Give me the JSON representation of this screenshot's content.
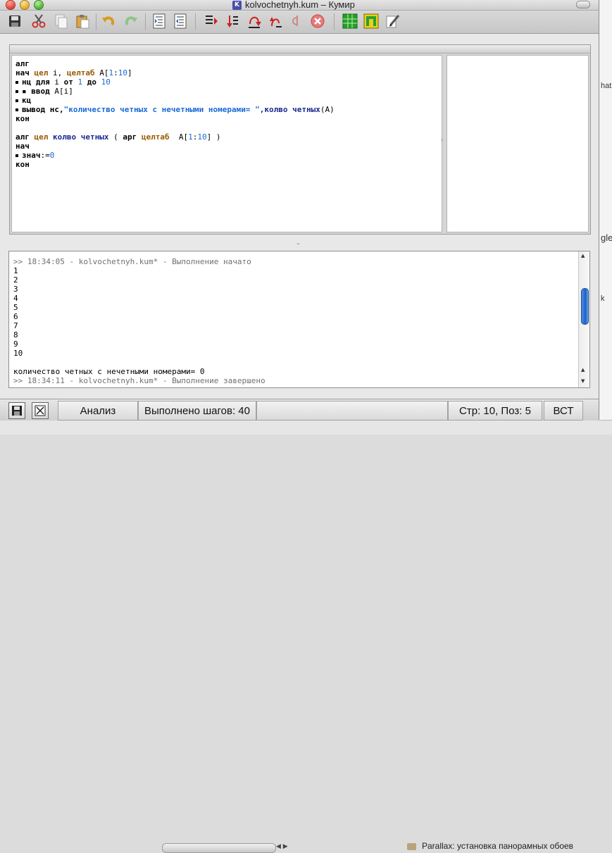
{
  "window": {
    "title": "kolvochetnyh.kum – Кумир",
    "app_icon": "K"
  },
  "toolbar": {
    "icons": [
      "save-icon",
      "cut-icon",
      "copy-icon",
      "paste-icon",
      "undo-icon",
      "redo-icon",
      "indent-icon",
      "outdent-icon",
      "run-icon",
      "step-in-icon",
      "step-over-icon",
      "step-out-icon",
      "step-back-icon",
      "stop-icon",
      "grid-robot-icon",
      "draw-board-icon",
      "pencil-icon"
    ]
  },
  "editor": {
    "lines": [
      {
        "mark": false,
        "segments": [
          {
            "t": "алг",
            "c": "kw"
          }
        ]
      },
      {
        "mark": false,
        "segments": [
          {
            "t": "нач ",
            "c": "kw"
          },
          {
            "t": "цел",
            "c": "ty"
          },
          {
            "t": " i, ",
            "c": "var"
          },
          {
            "t": "целтаб",
            "c": "ty"
          },
          {
            "t": " A[",
            "c": "var"
          },
          {
            "t": "1",
            "c": "num"
          },
          {
            "t": ":",
            "c": "var"
          },
          {
            "t": "10",
            "c": "num"
          },
          {
            "t": "]",
            "c": "var"
          }
        ]
      },
      {
        "mark": true,
        "segments": [
          {
            "t": "нц для ",
            "c": "kw"
          },
          {
            "t": "i ",
            "c": "var"
          },
          {
            "t": "от ",
            "c": "kw"
          },
          {
            "t": "1",
            "c": "num"
          },
          {
            "t": " до ",
            "c": "kw"
          },
          {
            "t": "10",
            "c": "num"
          }
        ]
      },
      {
        "mark": true,
        "segments": [
          {
            "t": "▪ ",
            "c": "var"
          },
          {
            "t": "ввод ",
            "c": "kw"
          },
          {
            "t": "A[i]",
            "c": "var"
          }
        ]
      },
      {
        "mark": true,
        "segments": [
          {
            "t": "кц",
            "c": "kw"
          }
        ]
      },
      {
        "mark": true,
        "segments": [
          {
            "t": "вывод нс,",
            "c": "kw"
          },
          {
            "t": "\"количество четных с нечетными номерами= \"",
            "c": "str"
          },
          {
            "t": ",колво четных",
            "c": "fn"
          },
          {
            "t": "(A)",
            "c": "var"
          }
        ]
      },
      {
        "mark": false,
        "segments": [
          {
            "t": "кон",
            "c": "kw"
          }
        ]
      },
      {
        "mark": false,
        "segments": [
          {
            "t": "",
            "c": "var"
          }
        ]
      },
      {
        "mark": false,
        "segments": [
          {
            "t": "алг ",
            "c": "kw"
          },
          {
            "t": "цел",
            "c": "ty"
          },
          {
            "t": " колво четных",
            "c": "fn"
          },
          {
            "t": " ( ",
            "c": "var"
          },
          {
            "t": "арг ",
            "c": "kw"
          },
          {
            "t": "целтаб",
            "c": "ty"
          },
          {
            "t": "  A[",
            "c": "var"
          },
          {
            "t": "1",
            "c": "num"
          },
          {
            "t": ":",
            "c": "var"
          },
          {
            "t": "10",
            "c": "num"
          },
          {
            "t": "] )",
            "c": "var"
          }
        ]
      },
      {
        "mark": false,
        "segments": [
          {
            "t": "нач",
            "c": "kw"
          }
        ]
      },
      {
        "mark": true,
        "segments": [
          {
            "t": "знач",
            "c": "kw"
          },
          {
            "t": ":=",
            "c": "var"
          },
          {
            "t": "0",
            "c": "num"
          }
        ]
      },
      {
        "mark": false,
        "segments": [
          {
            "t": "кон",
            "c": "kw"
          }
        ]
      }
    ]
  },
  "console": {
    "lines": [
      {
        "text": ">> 18:34:05 - kolvochetnyh.kum* - Выполнение начато",
        "gray": true
      },
      {
        "text": "1",
        "gray": false
      },
      {
        "text": "2",
        "gray": false
      },
      {
        "text": "3",
        "gray": false
      },
      {
        "text": "4",
        "gray": false
      },
      {
        "text": "5",
        "gray": false
      },
      {
        "text": "6",
        "gray": false
      },
      {
        "text": "7",
        "gray": false
      },
      {
        "text": "8",
        "gray": false
      },
      {
        "text": "9",
        "gray": false
      },
      {
        "text": "10",
        "gray": false
      },
      {
        "text": "",
        "gray": false
      },
      {
        "text": "количество четных с нечетными номерами= 0",
        "gray": false
      },
      {
        "text": ">> 18:34:11 - kolvochetnyh.kum* - Выполнение завершено",
        "gray": true
      }
    ]
  },
  "statusbar": {
    "analysis": "Анализ",
    "steps": "Выполнено шагов: 40",
    "position": "Стр: 10, Поз: 5",
    "mode": "ВСТ"
  },
  "background": {
    "fragments": [
      "hat",
      "k",
      "gle"
    ],
    "bottom_doc": "Parallax: установка панорамных обоев"
  }
}
